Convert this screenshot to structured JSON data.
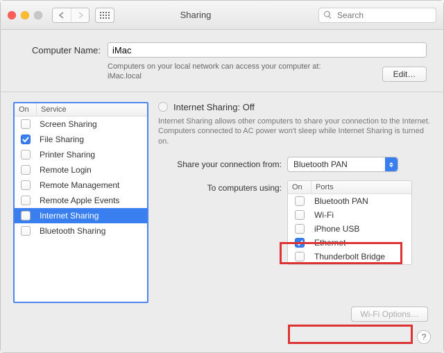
{
  "window": {
    "title": "Sharing",
    "search_placeholder": "Search"
  },
  "computer_name": {
    "label": "Computer Name:",
    "value": "iMac",
    "note_line1": "Computers on your local network can access your computer at:",
    "note_line2": "iMac.local",
    "edit_button": "Edit…"
  },
  "service_list": {
    "col_on": "On",
    "col_service": "Service",
    "items": [
      {
        "label": "Screen Sharing",
        "checked": false,
        "selected": false
      },
      {
        "label": "File Sharing",
        "checked": true,
        "selected": false
      },
      {
        "label": "Printer Sharing",
        "checked": false,
        "selected": false
      },
      {
        "label": "Remote Login",
        "checked": false,
        "selected": false
      },
      {
        "label": "Remote Management",
        "checked": false,
        "selected": false
      },
      {
        "label": "Remote Apple Events",
        "checked": false,
        "selected": false
      },
      {
        "label": "Internet Sharing",
        "checked": false,
        "selected": true
      },
      {
        "label": "Bluetooth Sharing",
        "checked": false,
        "selected": false
      }
    ]
  },
  "internet_sharing": {
    "title": "Internet Sharing: Off",
    "description": "Internet Sharing allows other computers to share your connection to the Internet. Computers connected to AC power won't sleep while Internet Sharing is turned on.",
    "share_from_label": "Share your connection from:",
    "share_from_value": "Bluetooth PAN",
    "to_label": "To computers using:",
    "ports_col_on": "On",
    "ports_col_ports": "Ports",
    "ports": [
      {
        "label": "Bluetooth PAN",
        "checked": false
      },
      {
        "label": "Wi-Fi",
        "checked": false
      },
      {
        "label": "iPhone USB",
        "checked": false
      },
      {
        "label": "Ethernet",
        "checked": true
      },
      {
        "label": "Thunderbolt Bridge",
        "checked": false
      }
    ],
    "wifi_options": "Wi-Fi Options…"
  },
  "help_icon": "?"
}
